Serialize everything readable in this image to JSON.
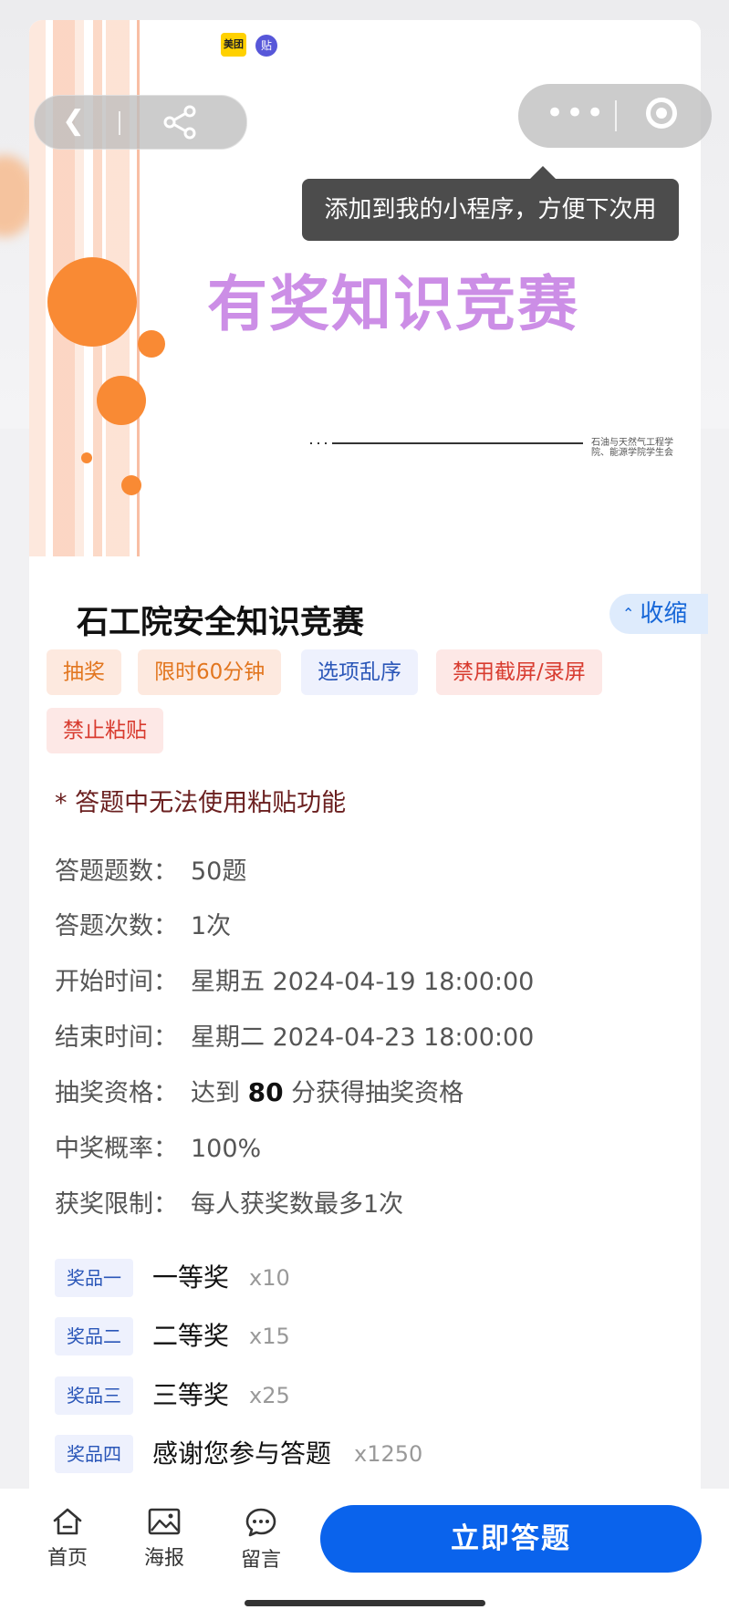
{
  "banner": {
    "title": "有奖知识竞赛",
    "organizer": "石油与天然气工程学院、能源学院学生会",
    "logos": [
      "美团",
      "贴"
    ]
  },
  "capsule": {
    "back_icon": "chevron-left-icon",
    "share_icon": "share-icon",
    "more_icon": "more-dots-icon",
    "close_icon": "target-circle-icon"
  },
  "tooltip": "添加到我的小程序，方便下次用",
  "quiz": {
    "title": "石工院安全知识竞赛",
    "collapse_label": "收缩",
    "tags": [
      "抽奖",
      "限时60分钟",
      "选项乱序",
      "禁用截屏/录屏",
      "禁止粘贴"
    ],
    "note": "* 答题中无法使用粘贴功能",
    "info": [
      {
        "label": "答题题数：",
        "value": "50题"
      },
      {
        "label": "答题次数：",
        "value": "1次"
      },
      {
        "label": "开始时间：",
        "value": "星期五 2024-04-19 18:00:00"
      },
      {
        "label": "结束时间：",
        "value": "星期二 2024-04-23 18:00:00"
      },
      {
        "label": "抽奖资格：",
        "prefix": "达到 ",
        "score": "80",
        "suffix": " 分获得抽奖资格"
      },
      {
        "label": "中奖概率：",
        "value": "100%"
      },
      {
        "label": "获奖限制：",
        "value": "每人获奖数最多1次"
      }
    ],
    "prizes": [
      {
        "badge": "奖品一",
        "name": "一等奖",
        "count": "x10"
      },
      {
        "badge": "奖品二",
        "name": "二等奖",
        "count": "x15"
      },
      {
        "badge": "奖品三",
        "name": "三等奖",
        "count": "x25"
      },
      {
        "badge": "奖品四",
        "name": "感谢您参与答题",
        "count": "x1250"
      }
    ]
  },
  "bottom_nav": {
    "items": [
      {
        "label": "首页",
        "icon": "home-icon"
      },
      {
        "label": "海报",
        "icon": "image-icon"
      },
      {
        "label": "留言",
        "icon": "chat-icon"
      }
    ],
    "cta": "立即答题"
  },
  "colors": {
    "primary": "#0a63ec",
    "banner_title": "#cc8ee6",
    "banner_circles": "#f98a34",
    "note": "#6b2020"
  }
}
